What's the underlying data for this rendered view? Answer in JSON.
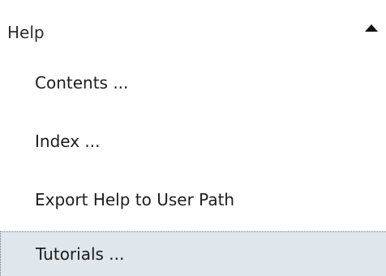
{
  "menu": {
    "title": "Help",
    "items": [
      {
        "label": "Contents ..."
      },
      {
        "label": "Index ..."
      },
      {
        "label": "Export Help to User Path"
      },
      {
        "label": "Tutorials ...",
        "state": "focused"
      }
    ]
  },
  "icons": {
    "collapse": "chevron-up-icon"
  },
  "colors": {
    "focused_background": "#dfe6ec",
    "text": "#1c1c1c"
  }
}
